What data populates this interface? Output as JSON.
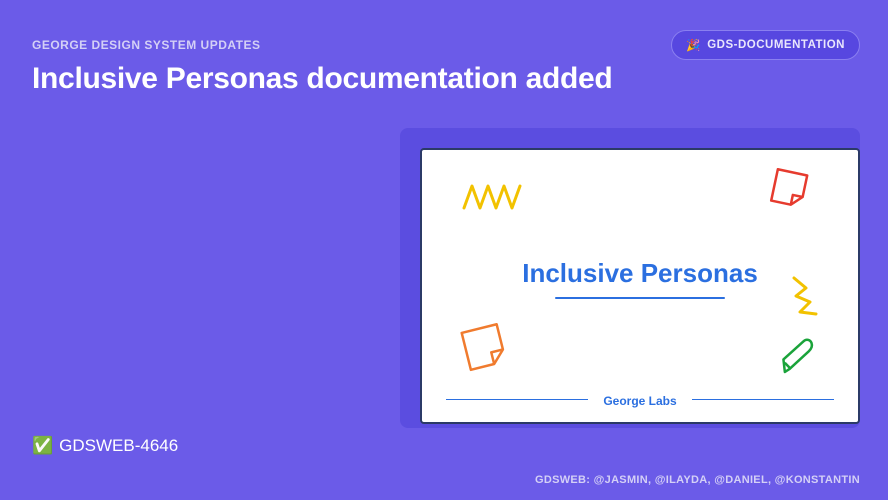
{
  "eyebrow": "GEORGE DESIGN SYSTEM UPDATES",
  "badge": {
    "emoji": "🎉",
    "label": "GDS-DOCUMENTATION"
  },
  "title": "Inclusive Personas documentation added",
  "card": {
    "title": "Inclusive Personas",
    "footer": "George Labs"
  },
  "ticket": {
    "emoji": "✅",
    "id": "GDSWEB-4646"
  },
  "credits": "GDSWEB: @JASMIN, @ILAYDA, @DANIEL, @KONSTANTIN"
}
